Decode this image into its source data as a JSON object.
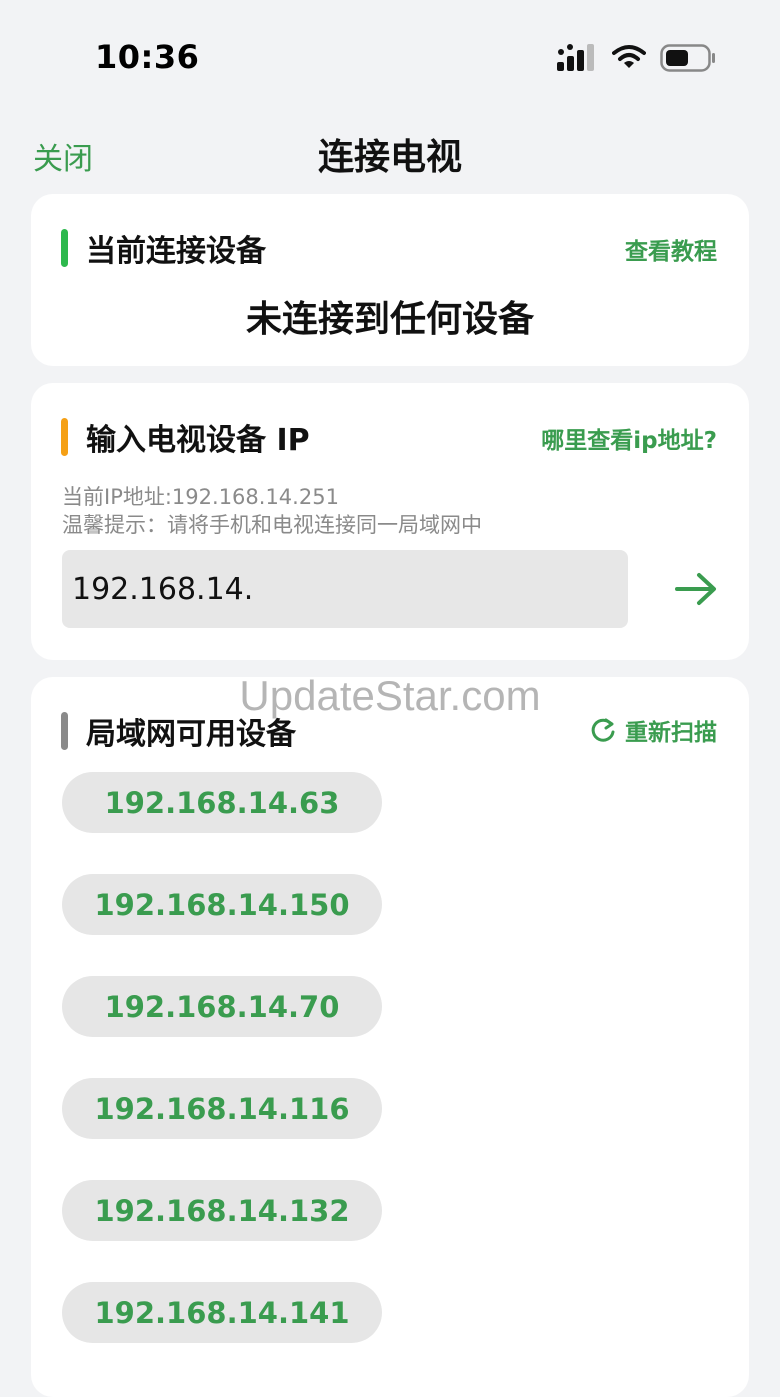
{
  "status_bar": {
    "time": "10:36"
  },
  "nav": {
    "close_label": "关闭",
    "title": "连接电视"
  },
  "current_section": {
    "title": "当前连接设备",
    "tutorial_link": "查看教程",
    "status": "未连接到任何设备"
  },
  "ip_section": {
    "title": "输入电视设备 IP",
    "help_link": "哪里查看ip地址?",
    "current_ip": "当前IP地址:192.168.14.251",
    "tip": "温馨提示：请将手机和电视连接同一局域网中",
    "input_value": "192.168.14."
  },
  "lan_section": {
    "title": "局域网可用设备",
    "rescan_label": "重新扫描",
    "devices": [
      "192.168.14.63",
      "192.168.14.150",
      "192.168.14.70",
      "192.168.14.116",
      "192.168.14.132",
      "192.168.14.141"
    ]
  },
  "watermark": "UpdateStar.com",
  "colors": {
    "accent_green": "#3a9c4f",
    "bar_green": "#2db84d",
    "bar_orange": "#f5a015",
    "bar_gray": "#8a8a8a",
    "background": "#f2f3f5"
  }
}
